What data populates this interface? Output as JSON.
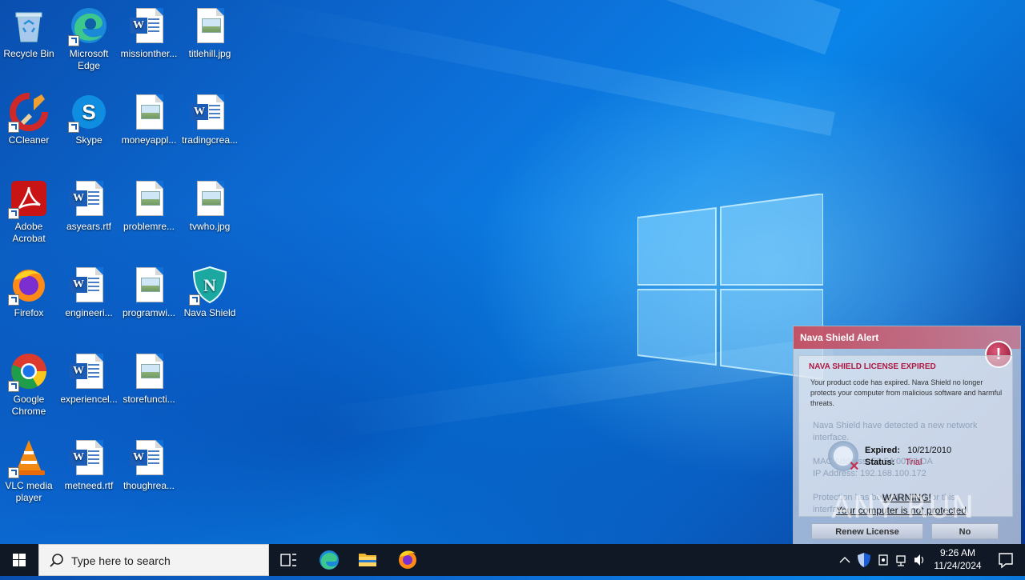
{
  "desktop": {
    "icons": [
      {
        "label": "Recycle Bin",
        "icon": "recycle-bin-icon"
      },
      {
        "label": "Microsoft Edge",
        "icon": "edge-icon"
      },
      {
        "label": "missionther...",
        "icon": "word-doc-icon"
      },
      {
        "label": "titlehill.jpg",
        "icon": "image-file-icon"
      },
      {
        "label": "CCleaner",
        "icon": "ccleaner-icon"
      },
      {
        "label": "Skype",
        "icon": "skype-icon"
      },
      {
        "label": "moneyappl...",
        "icon": "image-file-icon"
      },
      {
        "label": "tradingcrea...",
        "icon": "word-doc-icon"
      },
      {
        "label": "Adobe Acrobat",
        "icon": "acrobat-icon"
      },
      {
        "label": "asyears.rtf",
        "icon": "word-doc-icon"
      },
      {
        "label": "problemre...",
        "icon": "image-file-icon"
      },
      {
        "label": "tvwho.jpg",
        "icon": "image-file-icon"
      },
      {
        "label": "Firefox",
        "icon": "firefox-icon"
      },
      {
        "label": "engineeri...",
        "icon": "word-doc-icon"
      },
      {
        "label": "programwi...",
        "icon": "image-file-icon"
      },
      {
        "label": "Nava Shield",
        "icon": "nava-shield-icon"
      },
      {
        "label": "Google Chrome",
        "icon": "chrome-icon"
      },
      {
        "label": "experiencel...",
        "icon": "word-doc-icon"
      },
      {
        "label": "storefuncti...",
        "icon": "image-file-icon"
      },
      {
        "label": "VLC media player",
        "icon": "vlc-icon"
      },
      {
        "label": "metneed.rtf",
        "icon": "word-doc-icon"
      },
      {
        "label": "thoughrea...",
        "icon": "word-doc-icon"
      }
    ]
  },
  "alert": {
    "title": "Nava Shield Alert",
    "badge": "!",
    "headline": "NAVA SHIELD LICENSE EXPIRED",
    "description": "Your product code has expired. Nava Shield no longer protects your computer from malicious software and harmful threats.",
    "ghost_line1": "Nava Shield have detected a new network",
    "ghost_line2": "interface.",
    "ghost_line3": "MAC Address: 52:54:00:04:DA",
    "ghost_line4": "IP Address: 192.168.100.172",
    "ghost_line5": "Protection has been disabled for this",
    "ghost_line6": "interface.",
    "expired_label": "Expired:",
    "expired_value": "10/21/2010",
    "status_label": "Status:",
    "status_value": "Trial",
    "warning": "WARNING!",
    "warning_detail": "Your computer is not protected",
    "renew_button": "Renew License",
    "no_button": "No"
  },
  "watermark": "ANY RUN",
  "taskbar": {
    "search_placeholder": "Type here to search",
    "time": "9:26 AM",
    "date": "11/24/2024"
  },
  "colors": {
    "taskbar": "#101826",
    "alert_accent": "#b01840",
    "wallpaper": "#0a84e8"
  }
}
